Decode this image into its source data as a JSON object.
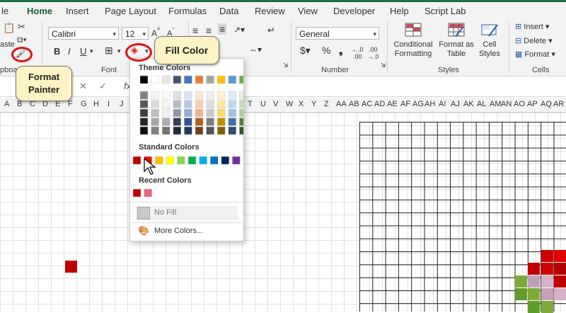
{
  "tabs": [
    "le",
    "Home",
    "Insert",
    "Page Layout",
    "Formulas",
    "Data",
    "Review",
    "View",
    "Developer",
    "Help",
    "Script Lab"
  ],
  "clipboard": {
    "paste_label": "aste",
    "group_label": "pboa"
  },
  "font": {
    "family": "Calibri",
    "size": "12",
    "group_label": "Font"
  },
  "number": {
    "format": "General",
    "group_label": "Number"
  },
  "styles": {
    "conditional": "Conditional Formatting",
    "format_table": "Format as Table",
    "cell_styles": "Cell Styles",
    "group_label": "Styles"
  },
  "cells": {
    "insert": "Insert",
    "delete": "Delete",
    "format": "Format",
    "group_label": "Cells"
  },
  "formula": {
    "fx": "fx"
  },
  "columns": [
    "A",
    "B",
    "C",
    "D",
    "E",
    "F",
    "G",
    "H",
    "I",
    "J",
    "T",
    "U",
    "V",
    "W",
    "X",
    "Y",
    "Z",
    "AA",
    "AB",
    "AC",
    "AD",
    "AE",
    "AF",
    "AG",
    "AH",
    "AI",
    "AJ",
    "AK",
    "AL",
    "AM",
    "AN",
    "AO",
    "AP",
    "AQ",
    "AR"
  ],
  "fill_menu": {
    "theme_title": "Theme Colors",
    "standard_title": "Standard Colors",
    "recent_title": "Recent Colors",
    "no_fill": "No Fill",
    "more_colors": "More Colors...",
    "theme_top": [
      "#000000",
      "#ffffff",
      "#e7e6e6",
      "#44546a",
      "#4472c4",
      "#ed7d31",
      "#a5a5a5",
      "#ffc000",
      "#5b9bd5",
      "#70ad47"
    ],
    "standard": [
      "#c00000",
      "#ff0000",
      "#ffc000",
      "#ffff00",
      "#92d050",
      "#00b050",
      "#00b0f0",
      "#0070c0",
      "#002060",
      "#7030a0"
    ],
    "recent": [
      "#c00000",
      "#f06080"
    ]
  },
  "callouts": {
    "fill_color": "Fill Color",
    "format_painter": "Format Painter"
  },
  "colors": {
    "accent": "#1e7145",
    "red": "#c00000"
  }
}
